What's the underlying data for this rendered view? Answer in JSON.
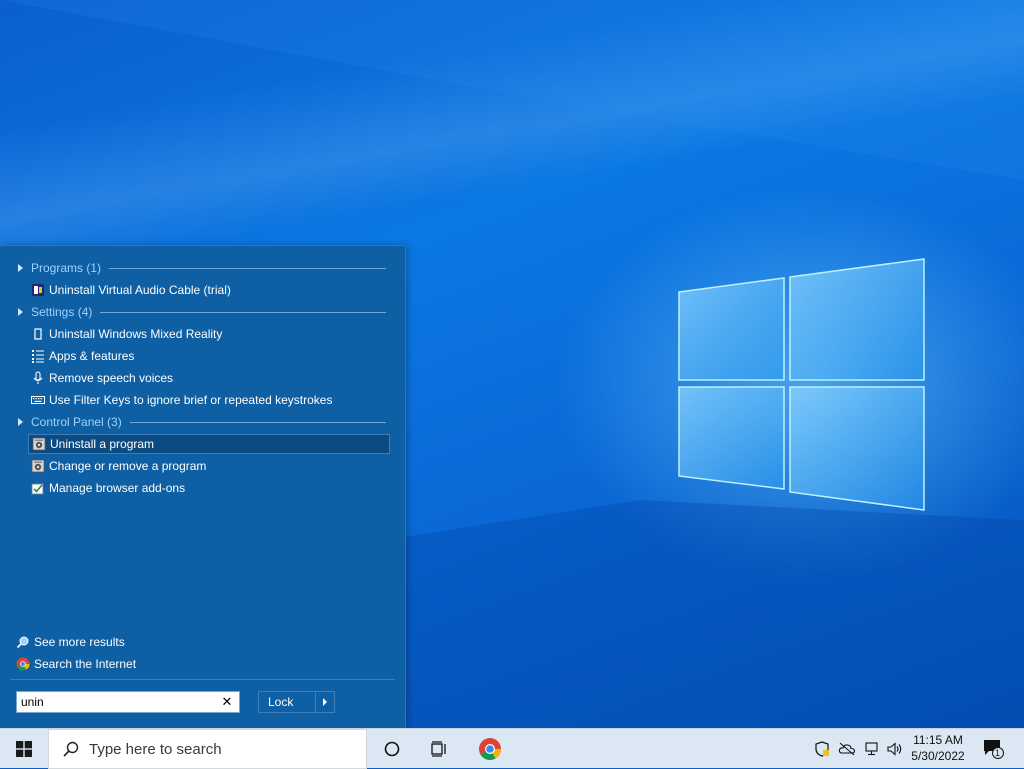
{
  "start_menu": {
    "groups": [
      {
        "header": "Programs (1)",
        "items": [
          {
            "label": "Uninstall Virtual Audio Cable (trial)",
            "icon": "audio-cable-icon"
          }
        ]
      },
      {
        "header": "Settings (4)",
        "items": [
          {
            "label": "Uninstall Windows Mixed Reality",
            "icon": "mixed-reality-icon"
          },
          {
            "label": "Apps & features",
            "icon": "apps-list-icon"
          },
          {
            "label": "Remove speech voices",
            "icon": "microphone-icon"
          },
          {
            "label": "Use Filter Keys to ignore brief or repeated keystrokes",
            "icon": "keyboard-icon"
          }
        ]
      },
      {
        "header": "Control Panel (3)",
        "items": [
          {
            "label": "Uninstall a program",
            "icon": "programs-icon",
            "selected": true
          },
          {
            "label": "Change or remove a program",
            "icon": "programs-icon"
          },
          {
            "label": "Manage browser add-ons",
            "icon": "browser-addons-icon"
          }
        ]
      }
    ],
    "see_more": "See more results",
    "search_internet": "Search the Internet",
    "search_value": "unin",
    "lock_label": "Lock"
  },
  "taskbar": {
    "search_placeholder": "Type here to search",
    "time": "11:15 AM",
    "date": "5/30/2022",
    "notification_count": "1"
  },
  "colors": {
    "menu_bg": "#0e5fa3",
    "group_header": "#9fd3ff",
    "selected_bg": "#0b4b82",
    "taskbar_bg": "#dbe7f3"
  }
}
